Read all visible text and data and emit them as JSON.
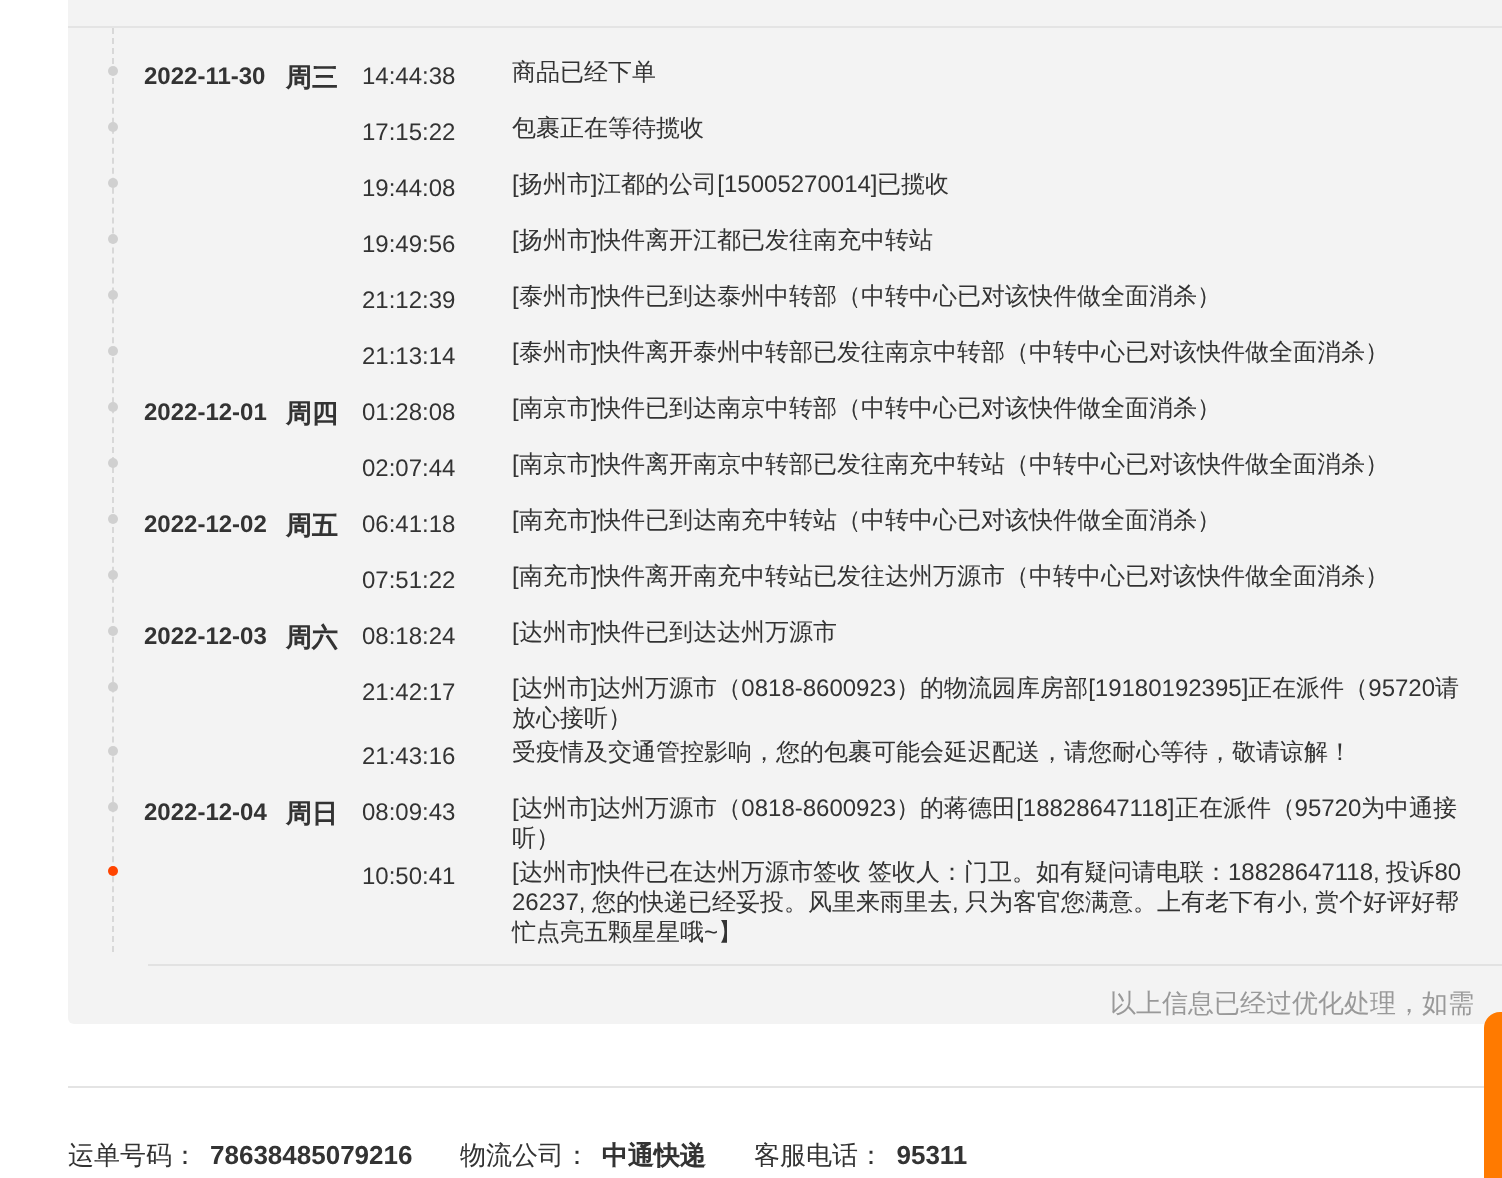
{
  "timeline": [
    {
      "date": "2022-11-30",
      "weekday": "周三",
      "time": "14:44:38",
      "text": "商品已经下单",
      "current": false
    },
    {
      "time": "17:15:22",
      "text": "包裹正在等待揽收",
      "current": false
    },
    {
      "time": "19:44:08",
      "text": "[扬州市]江都的公司[15005270014]已揽收",
      "current": false
    },
    {
      "time": "19:49:56",
      "text": "[扬州市]快件离开江都已发往南充中转站",
      "current": false
    },
    {
      "time": "21:12:39",
      "text": "[泰州市]快件已到达泰州中转部（中转中心已对该快件做全面消杀）",
      "current": false
    },
    {
      "time": "21:13:14",
      "text": "[泰州市]快件离开泰州中转部已发往南京中转部（中转中心已对该快件做全面消杀）",
      "current": false
    },
    {
      "date": "2022-12-01",
      "weekday": "周四",
      "time": "01:28:08",
      "text": "[南京市]快件已到达南京中转部（中转中心已对该快件做全面消杀）",
      "current": false
    },
    {
      "time": "02:07:44",
      "text": "[南京市]快件离开南京中转部已发往南充中转站（中转中心已对该快件做全面消杀）",
      "current": false
    },
    {
      "date": "2022-12-02",
      "weekday": "周五",
      "time": "06:41:18",
      "text": "[南充市]快件已到达南充中转站（中转中心已对该快件做全面消杀）",
      "current": false
    },
    {
      "time": "07:51:22",
      "text": "[南充市]快件离开南充中转站已发往达州万源市（中转中心已对该快件做全面消杀）",
      "current": false
    },
    {
      "date": "2022-12-03",
      "weekday": "周六",
      "time": "08:18:24",
      "text": "[达州市]快件已到达达州万源市",
      "current": false
    },
    {
      "time": "21:42:17",
      "text": "[达州市]达州万源市（0818-8600923）的物流园库房部[19180192395]正在派件（95720请放心接听）",
      "current": false
    },
    {
      "time": "21:43:16",
      "text": "受疫情及交通管控影响，您的包裹可能会延迟配送，请您耐心等待，敬请谅解！",
      "current": false
    },
    {
      "date": "2022-12-04",
      "weekday": "周日",
      "time": "08:09:43",
      "text": "[达州市]达州万源市（0818-8600923）的蒋德田[18828647118]正在派件（95720为中通接听）",
      "current": false
    },
    {
      "time": "10:50:41",
      "text": "[达州市]快件已在达州万源市签收 签收人：门卫。如有疑问请电联：18828647118, 投诉8026237, 您的快递已经妥投。风里来雨里去, 只为客官您满意。上有老下有小, 赏个好评好帮忙点亮五颗星星哦~】",
      "current": true
    }
  ],
  "note": "以上信息已经过优化处理，如需",
  "footer": [
    {
      "label": "运单号码：",
      "value": "78638485079216"
    },
    {
      "label": "物流公司：",
      "value": "中通快递"
    },
    {
      "label": "客服电话：",
      "value": "95311"
    }
  ]
}
